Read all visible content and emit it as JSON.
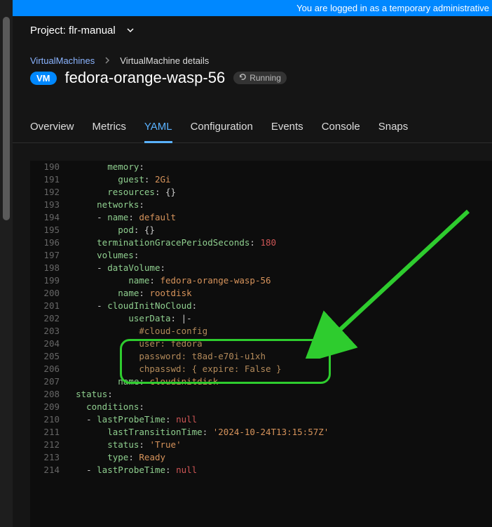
{
  "banner": {
    "text": "You are logged in as a temporary administrative"
  },
  "project": {
    "label": "Project:",
    "name": "flr-manual"
  },
  "breadcrumb": {
    "link": "VirtualMachines",
    "current": "VirtualMachine details"
  },
  "vm": {
    "badge": "VM",
    "name": "fedora-orange-wasp-56",
    "status": "Running"
  },
  "tabs": [
    "Overview",
    "Metrics",
    "YAML",
    "Configuration",
    "Events",
    "Console",
    "Snaps"
  ],
  "active_tab": "YAML",
  "yaml": [
    {
      "no": 190,
      "indent": 8,
      "key": "memory",
      "val": ""
    },
    {
      "no": 191,
      "indent": 10,
      "key": "guest",
      "val": "2Gi",
      "vcls": "s"
    },
    {
      "no": 192,
      "indent": 8,
      "key": "resources",
      "val": "{}",
      "vcls": "p"
    },
    {
      "no": 193,
      "indent": 6,
      "key": "networks",
      "val": ""
    },
    {
      "no": 194,
      "indent": 8,
      "dash": true,
      "key": "name",
      "val": "default",
      "vcls": "s"
    },
    {
      "no": 195,
      "indent": 10,
      "key": "pod",
      "val": "{}",
      "vcls": "p"
    },
    {
      "no": 196,
      "indent": 6,
      "key": "terminationGracePeriodSeconds",
      "val": "180",
      "vcls": "n"
    },
    {
      "no": 197,
      "indent": 6,
      "key": "volumes",
      "val": ""
    },
    {
      "no": 198,
      "indent": 8,
      "dash": true,
      "key": "dataVolume",
      "val": ""
    },
    {
      "no": 199,
      "indent": 12,
      "key": "name",
      "val": "fedora-orange-wasp-56",
      "vcls": "s"
    },
    {
      "no": 200,
      "indent": 10,
      "key": "name",
      "val": "rootdisk",
      "vcls": "s"
    },
    {
      "no": 201,
      "indent": 8,
      "dash": true,
      "key": "cloudInitNoCloud",
      "val": ""
    },
    {
      "no": 202,
      "indent": 12,
      "key": "userData",
      "val": "|-",
      "vcls": "p"
    },
    {
      "no": 203,
      "indent": 14,
      "plain": "#cloud-config",
      "pcls": "c"
    },
    {
      "no": 204,
      "indent": 14,
      "plain": "user: fedora",
      "pcls": "c"
    },
    {
      "no": 205,
      "indent": 14,
      "plain": "password: t8ad-e70i-u1xh",
      "pcls": "c"
    },
    {
      "no": 206,
      "indent": 14,
      "plain": "chpasswd: { expire: False }",
      "pcls": "c"
    },
    {
      "no": 207,
      "indent": 10,
      "key": "name",
      "val": "cloudinitdisk",
      "vcls": "s"
    },
    {
      "no": 208,
      "indent": 2,
      "key": "status",
      "val": ""
    },
    {
      "no": 209,
      "indent": 4,
      "key": "conditions",
      "val": ""
    },
    {
      "no": 210,
      "indent": 6,
      "dash": true,
      "key": "lastProbeTime",
      "val": "null",
      "vcls": "n"
    },
    {
      "no": 211,
      "indent": 8,
      "key": "lastTransitionTime",
      "val": "'2024-10-24T13:15:57Z'",
      "vcls": "s"
    },
    {
      "no": 212,
      "indent": 8,
      "key": "status",
      "val": "'True'",
      "vcls": "s"
    },
    {
      "no": 213,
      "indent": 8,
      "key": "type",
      "val": "Ready",
      "vcls": "s"
    },
    {
      "no": 214,
      "indent": 6,
      "dash": true,
      "key": "lastProbeTime",
      "val": "null",
      "vcls": "n"
    }
  ]
}
